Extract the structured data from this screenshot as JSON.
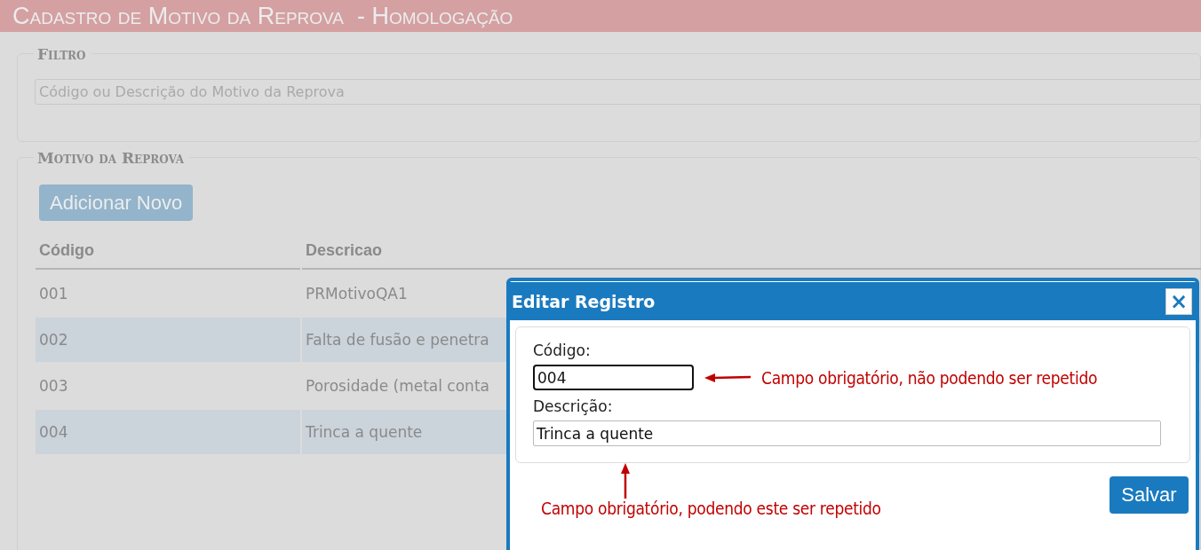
{
  "header": {
    "title": "Cadastro de Motivo da Reprova  - Homologação"
  },
  "filter": {
    "legend": "Filtro",
    "search": {
      "placeholder": "Código ou Descrição do Motivo da Reprova"
    }
  },
  "list": {
    "legend": "Motivo da Reprova",
    "add_button": "Adicionar Novo",
    "table": {
      "columns": [
        "Código",
        "Descricao"
      ],
      "rows": [
        {
          "cells": [
            "001",
            "PRMotivoQA1"
          ]
        },
        {
          "cells": [
            "002",
            "Falta de fusão e penetra"
          ]
        },
        {
          "cells": [
            "003",
            "Porosidade (metal conta"
          ]
        },
        {
          "cells": [
            "004",
            "Trinca a quente"
          ]
        }
      ]
    }
  },
  "dialog": {
    "title": "Editar Registro",
    "close": "×",
    "fields": [
      {
        "label": "Código:",
        "value": "004",
        "focused": true,
        "note": "Campo obrigatório, não podendo ser repetido"
      },
      {
        "label": "Descrição:",
        "value": "Trinca a quente",
        "focused": false,
        "note": "Campo obrigatório, podendo este ser repetido"
      }
    ],
    "save_button": "Salvar"
  }
}
